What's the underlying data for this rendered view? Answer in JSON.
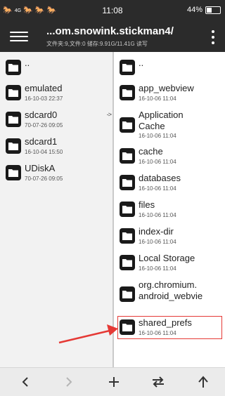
{
  "status_bar": {
    "left_glyphs": [
      "🐎",
      "4G",
      "🐎",
      "🐎",
      "🐎"
    ],
    "time": "11:08",
    "battery_text": "44%",
    "battery_level": 0.44
  },
  "toolbar": {
    "title": "...om.snowink.stickman4/",
    "subtitle": "文件夹:9,文件:0   储存:9.91G/11.41G   读写"
  },
  "left_pane": {
    "items": [
      {
        "name": "..",
        "date": ""
      },
      {
        "name": "emulated",
        "date": "16-10-03 22:37"
      },
      {
        "name": "sdcard0",
        "date": "70-07-26 09:05",
        "indicator": "->"
      },
      {
        "name": "sdcard1",
        "date": "16-10-04 15:50"
      },
      {
        "name": "UDiskA",
        "date": "70-07-26 09:05"
      }
    ]
  },
  "right_pane": {
    "items": [
      {
        "name": "..",
        "date": ""
      },
      {
        "name": "app_webview",
        "date": "16-10-06 11:04"
      },
      {
        "name": "Application Cache",
        "name_line1": "Application",
        "name_line2": "Cache",
        "date": "16-10-06 11:04"
      },
      {
        "name": "cache",
        "date": "16-10-06 11:04"
      },
      {
        "name": "databases",
        "date": "16-10-06 11:04"
      },
      {
        "name": "files",
        "date": "16-10-06 11:04"
      },
      {
        "name": "index-dir",
        "date": "16-10-06 11:04"
      },
      {
        "name": "Local Storage",
        "date": "16-10-06 11:04"
      },
      {
        "name": "org.chromium.android_webvie",
        "name_line1": "org.chromium.",
        "name_line2": "android_webvie",
        "date": ""
      },
      {
        "name": "shared_prefs",
        "date": "16-10-06 11:04"
      }
    ]
  },
  "bottom_bar": {
    "buttons": [
      "back-icon",
      "forward-icon",
      "add-icon",
      "swap-icon",
      "up-icon"
    ]
  },
  "colors": {
    "toolbar_bg": "#2b2b2b",
    "highlight": "#e53935",
    "left_pane_bg": "#f2f2f2"
  }
}
